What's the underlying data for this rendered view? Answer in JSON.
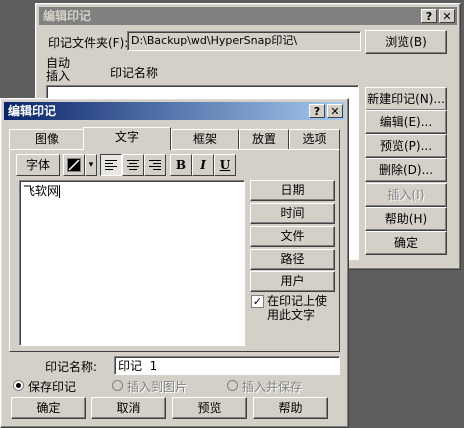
{
  "back_dialog": {
    "title": "编辑印记",
    "help_button": "?",
    "close_button": "✕",
    "folder_label": "印记文件夹(F):",
    "folder_value": "D:\\Backup\\wd\\HyperSnap印记\\",
    "browse_button": "浏览(B)",
    "auto_insert_label": "自动\n插入",
    "name_column_header": "印记名称",
    "buttons": {
      "new": "新建印记(N)...",
      "edit": "编辑(E)...",
      "preview": "预览(P)...",
      "delete": "删除(D)...",
      "insert": "插入(I)",
      "help": "帮助(H)",
      "ok": "确定"
    }
  },
  "front_dialog": {
    "title": "编辑印记",
    "help_button": "?",
    "close_button": "✕",
    "tabs": [
      "图像",
      "文字",
      "框架",
      "放置",
      "选项"
    ],
    "selected_tab": "文字",
    "toolbar": {
      "font_label": "字体",
      "dropdown_arrow": "▾",
      "bold": "B",
      "italic": "I",
      "underline": "U"
    },
    "text_content": "飞软网",
    "side_buttons": [
      "日期",
      "时间",
      "文件",
      "路径",
      "用户"
    ],
    "stamp_text_checkbox": {
      "label": "在印记上使\n用此文字",
      "checked": true,
      "mark": "✓"
    },
    "name_label": "印记名称:",
    "name_value": "印记  1",
    "radios": {
      "save": {
        "label": "保存印记",
        "selected": true,
        "enabled": true
      },
      "insert_to_image": {
        "label": "插入到图片",
        "selected": false,
        "enabled": false
      },
      "insert_and_save": {
        "label": "插入并保存",
        "selected": false,
        "enabled": false
      }
    },
    "bottom_buttons": {
      "ok": "确定",
      "cancel": "取消",
      "preview": "预览",
      "help": "帮助"
    }
  }
}
